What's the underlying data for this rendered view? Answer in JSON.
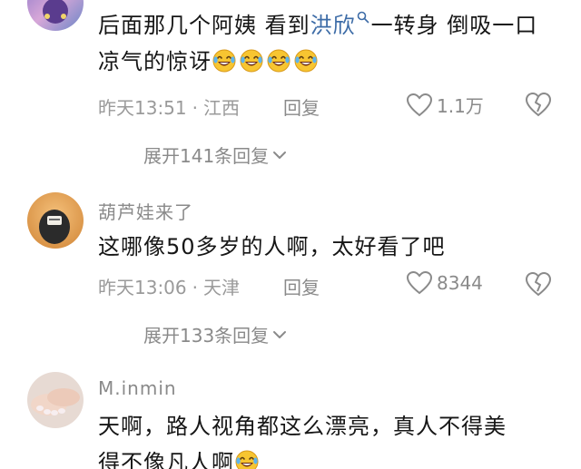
{
  "comments": [
    {
      "username": "",
      "text_before": "后面那几个阿姨 看到",
      "link_text": "洪欣",
      "text_after": "一转身 倒吸一口凉气的惊讶",
      "emoji_count": 4,
      "time": "昨天13:51",
      "location": "江西",
      "reply_label": "回复",
      "likes": "1.1万",
      "expand_label": "展开141条回复"
    },
    {
      "username": "葫芦娃来了",
      "text": "这哪像50多岁的人啊，太好看了吧",
      "time": "昨天13:06",
      "location": "天津",
      "reply_label": "回复",
      "likes": "8344",
      "expand_label": "展开133条回复"
    },
    {
      "username": "M.inmin",
      "text_line1": "天啊，路人视角都这么漂亮，真人不得美",
      "text_line2": "得不像凡人啊",
      "emoji_count": 1
    }
  ],
  "separator": "·",
  "colors": {
    "link": "#3d6ca7",
    "meta": "#9a9a9a",
    "text": "#161616",
    "emoji_face": "#f7c531"
  },
  "icons": [
    "heart-outline-icon",
    "broken-heart-icon",
    "chevron-down-icon",
    "search-icon",
    "laughing-crying-emoji"
  ]
}
